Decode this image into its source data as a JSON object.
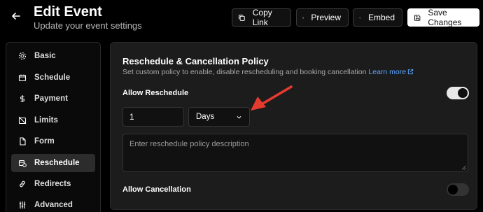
{
  "header": {
    "title": "Edit Event",
    "subtitle": "Update your event settings",
    "buttons": {
      "copy_link": "Copy Link",
      "preview": "Preview",
      "embed": "Embed",
      "save": "Save Changes"
    }
  },
  "sidebar": {
    "items": [
      {
        "label": "Basic",
        "icon": "gear-icon"
      },
      {
        "label": "Schedule",
        "icon": "calendar-icon"
      },
      {
        "label": "Payment",
        "icon": "dollar-icon"
      },
      {
        "label": "Limits",
        "icon": "calendar-off-icon"
      },
      {
        "label": "Form",
        "icon": "file-icon"
      },
      {
        "label": "Reschedule",
        "icon": "calendar-clock-icon"
      },
      {
        "label": "Redirects",
        "icon": "link-icon"
      },
      {
        "label": "Advanced",
        "icon": "sliders-icon"
      }
    ],
    "active": "Reschedule"
  },
  "policy": {
    "title": "Reschedule & Cancellation Policy",
    "description": "Set custom policy to enable, disable rescheduling and booking cancellation",
    "learn_more": "Learn more",
    "allow_reschedule_label": "Allow Reschedule",
    "allow_reschedule_on": true,
    "period_value": "1",
    "period_unit": "Days",
    "reschedule_placeholder": "Enter reschedule policy description",
    "allow_cancellation_label": "Allow Cancellation",
    "allow_cancellation_on": false
  },
  "colors": {
    "background": "#000000",
    "panel": "#1c1c1c",
    "link": "#5ba4ff",
    "annotation_arrow": "#e53b2f"
  }
}
